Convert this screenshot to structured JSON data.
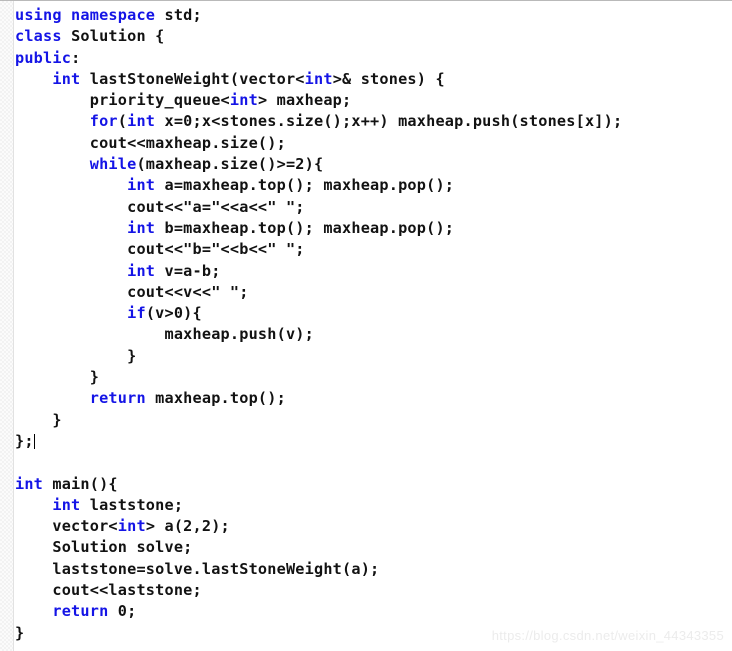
{
  "editor": {
    "language": "cpp",
    "colors": {
      "background": "#ffffff",
      "foreground": "#121212",
      "keyword": "#1414e6",
      "gutter": "#fbfbfb",
      "watermark": "#ececec",
      "top_border": "#b9b9b9"
    },
    "cursor_line_index": 21
  },
  "watermark": {
    "text": "https://blog.csdn.net/weixin_44343355"
  },
  "code": {
    "lines": [
      {
        "index": 0,
        "tokens": [
          {
            "t": "using namespace ",
            "k": true
          },
          {
            "t": "std;",
            "k": false
          }
        ]
      },
      {
        "index": 1,
        "tokens": [
          {
            "t": "class ",
            "k": true
          },
          {
            "t": "Solution {",
            "k": false
          }
        ]
      },
      {
        "index": 2,
        "tokens": [
          {
            "t": "public",
            "k": true
          },
          {
            "t": ":",
            "k": false
          }
        ]
      },
      {
        "index": 3,
        "tokens": [
          {
            "t": "    ",
            "k": false
          },
          {
            "t": "int",
            "k": true
          },
          {
            "t": " lastStoneWeight(vector<",
            "k": false
          },
          {
            "t": "int",
            "k": true
          },
          {
            "t": ">& stones) {",
            "k": false
          }
        ]
      },
      {
        "index": 4,
        "tokens": [
          {
            "t": "        priority_queue<",
            "k": false
          },
          {
            "t": "int",
            "k": true
          },
          {
            "t": "> maxheap;",
            "k": false
          }
        ]
      },
      {
        "index": 5,
        "tokens": [
          {
            "t": "        ",
            "k": false
          },
          {
            "t": "for",
            "k": true
          },
          {
            "t": "(",
            "k": false
          },
          {
            "t": "int",
            "k": true
          },
          {
            "t": " x=0;x<stones.size();x++) maxheap.push(stones[x]);",
            "k": false
          }
        ]
      },
      {
        "index": 6,
        "tokens": [
          {
            "t": "        cout<<maxheap.size();",
            "k": false
          }
        ]
      },
      {
        "index": 7,
        "tokens": [
          {
            "t": "        ",
            "k": false
          },
          {
            "t": "while",
            "k": true
          },
          {
            "t": "(maxheap.size()>=2){",
            "k": false
          }
        ]
      },
      {
        "index": 8,
        "tokens": [
          {
            "t": "            ",
            "k": false
          },
          {
            "t": "int",
            "k": true
          },
          {
            "t": " a=maxheap.top(); maxheap.pop();",
            "k": false
          }
        ]
      },
      {
        "index": 9,
        "tokens": [
          {
            "t": "            cout<<\"a=\"<<a<<\" \";",
            "k": false
          }
        ]
      },
      {
        "index": 10,
        "tokens": [
          {
            "t": "            ",
            "k": false
          },
          {
            "t": "int",
            "k": true
          },
          {
            "t": " b=maxheap.top(); maxheap.pop();",
            "k": false
          }
        ]
      },
      {
        "index": 11,
        "tokens": [
          {
            "t": "            cout<<\"b=\"<<b<<\" \";",
            "k": false
          }
        ]
      },
      {
        "index": 12,
        "tokens": [
          {
            "t": "            ",
            "k": false
          },
          {
            "t": "int",
            "k": true
          },
          {
            "t": " v=a-b;",
            "k": false
          }
        ]
      },
      {
        "index": 13,
        "tokens": [
          {
            "t": "            cout<<v<<\" \";",
            "k": false
          }
        ]
      },
      {
        "index": 14,
        "tokens": [
          {
            "t": "            ",
            "k": false
          },
          {
            "t": "if",
            "k": true
          },
          {
            "t": "(v>0){",
            "k": false
          }
        ]
      },
      {
        "index": 15,
        "tokens": [
          {
            "t": "                maxheap.push(v);",
            "k": false
          }
        ]
      },
      {
        "index": 16,
        "tokens": [
          {
            "t": "            }",
            "k": false
          }
        ]
      },
      {
        "index": 17,
        "tokens": [
          {
            "t": "        }",
            "k": false
          }
        ]
      },
      {
        "index": 18,
        "tokens": [
          {
            "t": "        ",
            "k": false
          },
          {
            "t": "return",
            "k": true
          },
          {
            "t": " maxheap.top();",
            "k": false
          }
        ]
      },
      {
        "index": 19,
        "tokens": [
          {
            "t": "    }",
            "k": false
          }
        ]
      },
      {
        "index": 20,
        "tokens": [
          {
            "t": "};",
            "k": false
          }
        ],
        "cursor": true
      },
      {
        "index": 21,
        "tokens": [
          {
            "t": "",
            "k": false
          }
        ]
      },
      {
        "index": 22,
        "tokens": [
          {
            "t": "int",
            "k": true
          },
          {
            "t": " main(){",
            "k": false
          }
        ]
      },
      {
        "index": 23,
        "tokens": [
          {
            "t": "    ",
            "k": false
          },
          {
            "t": "int",
            "k": true
          },
          {
            "t": " laststone;",
            "k": false
          }
        ]
      },
      {
        "index": 24,
        "tokens": [
          {
            "t": "    vector<",
            "k": false
          },
          {
            "t": "int",
            "k": true
          },
          {
            "t": "> a(2,2);",
            "k": false
          }
        ]
      },
      {
        "index": 25,
        "tokens": [
          {
            "t": "    Solution solve;",
            "k": false
          }
        ]
      },
      {
        "index": 26,
        "tokens": [
          {
            "t": "    laststone=solve.lastStoneWeight(a);",
            "k": false
          }
        ]
      },
      {
        "index": 27,
        "tokens": [
          {
            "t": "    cout<<laststone;",
            "k": false
          }
        ]
      },
      {
        "index": 28,
        "tokens": [
          {
            "t": "    ",
            "k": false
          },
          {
            "t": "return",
            "k": true
          },
          {
            "t": " 0;",
            "k": false
          }
        ]
      },
      {
        "index": 29,
        "tokens": [
          {
            "t": "}",
            "k": false
          }
        ]
      }
    ]
  }
}
